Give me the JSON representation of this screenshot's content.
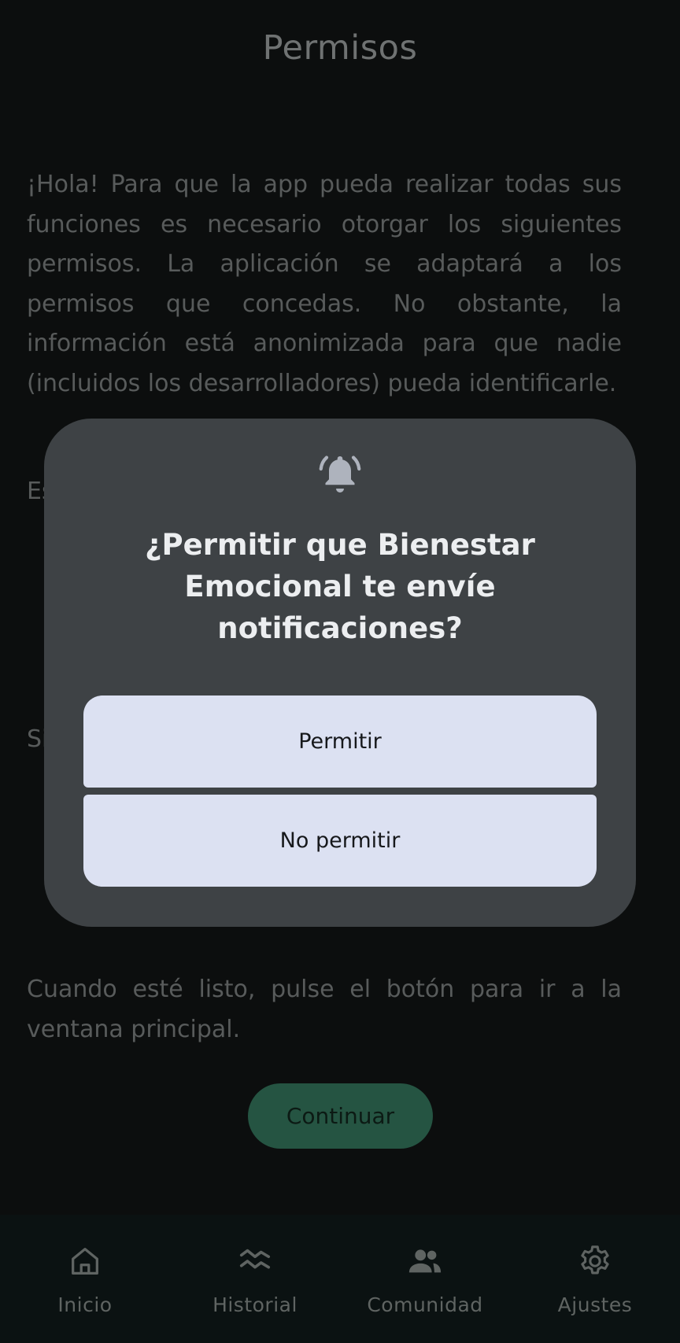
{
  "header": {
    "title": "Permisos"
  },
  "content": {
    "paragraphs": [
      "¡Hola! Para que la app pueda realizar todas sus funciones es necesario otorgar los siguientes permisos. La aplicación se adaptará a los permisos que concedas. No obstante, la información está anonimizada para que nadie (incluidos los desarrolladores) pueda identificarle.",
      "Es",
      "Si",
      "Cuando esté listo, pulse el botón para ir a la ventana principal."
    ],
    "continue_label": "Continuar"
  },
  "dialog": {
    "icon": "bell-ringing-icon",
    "title_prefix": "¿Permitir que ",
    "app_name": "Bienestar Emocional",
    "title_suffix": " te envíe notificaciones?",
    "allow_label": "Permitir",
    "deny_label": "No permitir"
  },
  "nav": {
    "items": [
      {
        "label": "Inicio",
        "icon": "home-icon"
      },
      {
        "label": "Historial",
        "icon": "history-icon"
      },
      {
        "label": "Comunidad",
        "icon": "community-icon"
      },
      {
        "label": "Ajustes",
        "icon": "settings-icon"
      }
    ]
  },
  "colors": {
    "background": "#0c0e0e",
    "dialog_bg": "#3e4245",
    "dialog_button": "#dce1f2",
    "accent_green": "#255442",
    "nav_bg": "#0b1212"
  }
}
